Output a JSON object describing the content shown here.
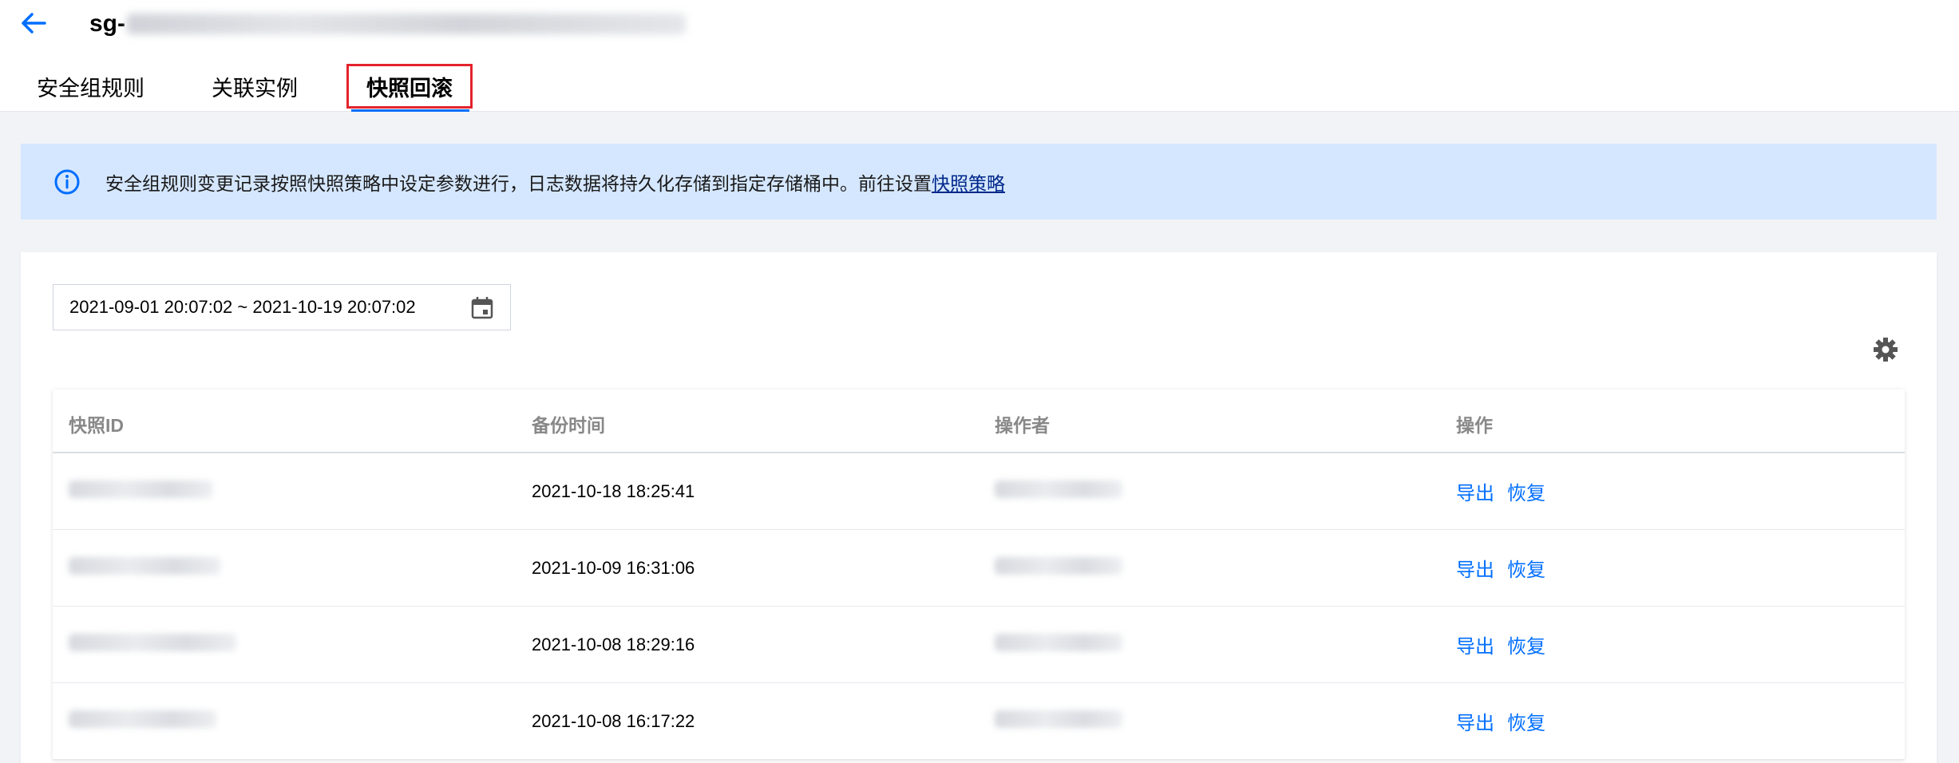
{
  "header": {
    "title_prefix": "sg-",
    "tabs": [
      {
        "label": "安全组规则"
      },
      {
        "label": "关联实例"
      },
      {
        "label": "快照回滚"
      }
    ]
  },
  "notice": {
    "text": "安全组规则变更记录按照快照策略中设定参数进行，日志数据将持久化存储到指定存储桶中。前往设置",
    "link": "快照策略"
  },
  "filter": {
    "date_range": "2021-09-01 20:07:02 ~ 2021-10-19 20:07:02"
  },
  "table": {
    "columns": [
      "快照ID",
      "备份时间",
      "操作者",
      "操作"
    ],
    "rows": [
      {
        "backup_time": "2021-10-18 18:25:41",
        "actions": [
          "导出",
          "恢复"
        ]
      },
      {
        "backup_time": "2021-10-09 16:31:06",
        "actions": [
          "导出",
          "恢复"
        ]
      },
      {
        "backup_time": "2021-10-08 18:29:16",
        "actions": [
          "导出",
          "恢复"
        ]
      },
      {
        "backup_time": "2021-10-08 16:17:22",
        "actions": [
          "导出",
          "恢复"
        ]
      }
    ]
  },
  "icons": {
    "back": "arrow-left-icon",
    "info": "info-circle-icon",
    "calendar": "calendar-icon",
    "settings": "gear-icon"
  },
  "colors": {
    "accent": "#006eff",
    "notice_bg": "#d5e7ff",
    "highlight_border": "#e3232c"
  }
}
